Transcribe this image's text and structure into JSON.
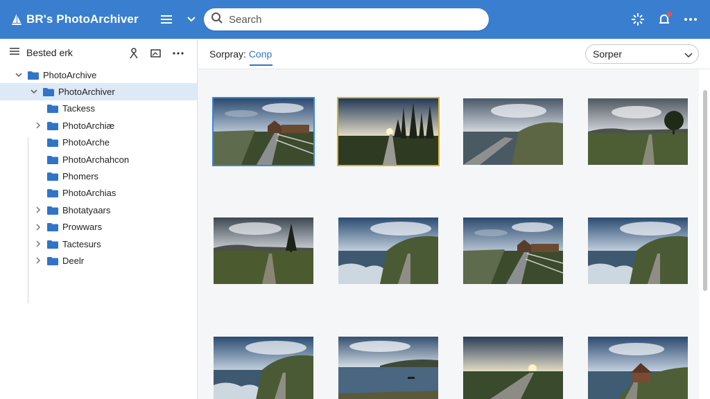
{
  "app": {
    "title": "BR's PhotoArchiver",
    "accent": "#3a7fcf"
  },
  "header": {
    "search_placeholder": "Search",
    "icons": [
      "menu-icon",
      "chevron-down-icon",
      "search-icon",
      "sparkle-icon",
      "bell-icon",
      "more-icon"
    ],
    "notification_badge_color": "#e8534a"
  },
  "sidebar": {
    "header_label": "Bested erk",
    "tree": [
      {
        "label": "PhotoArchive",
        "level": 0,
        "toggle": "expanded",
        "selected": false
      },
      {
        "label": "PhotoArchiver",
        "level": 1,
        "toggle": "expanded",
        "selected": true
      },
      {
        "label": "Tackess",
        "level": 2,
        "toggle": "none",
        "selected": false
      },
      {
        "label": "PhotoArchiæ",
        "level": 2,
        "toggle": "collapsed",
        "selected": false
      },
      {
        "label": "PhotoArche",
        "level": 2,
        "toggle": "none",
        "selected": false
      },
      {
        "label": "PhotoArchahcon",
        "level": 2,
        "toggle": "none",
        "selected": false
      },
      {
        "label": "Phomers",
        "level": 2,
        "toggle": "none",
        "selected": false
      },
      {
        "label": "PhotoArchias",
        "level": 2,
        "toggle": "none",
        "selected": false
      },
      {
        "label": "Bhotatyaars",
        "level": 2,
        "toggle": "collapsed",
        "selected": false
      },
      {
        "label": "Prowwars",
        "level": 2,
        "toggle": "collapsed",
        "selected": false
      },
      {
        "label": "Tactesurs",
        "level": 2,
        "toggle": "collapsed",
        "selected": false
      },
      {
        "label": "Deelr",
        "level": 2,
        "toggle": "collapsed",
        "selected": false
      }
    ]
  },
  "main": {
    "breadcrumb_key": "Sorpray:",
    "breadcrumb_value": "Conp",
    "sort_label": "Sorper",
    "photos": [
      {
        "scene": "boardwalk-hut",
        "selected": "blue"
      },
      {
        "scene": "sunset-path-trees",
        "selected": "gold"
      },
      {
        "scene": "coast-boardwalk",
        "selected": "none"
      },
      {
        "scene": "meadow-tree-path",
        "selected": "none"
      },
      {
        "scene": "tree-field-path",
        "selected": "none"
      },
      {
        "scene": "coast-waves-path",
        "selected": "none"
      },
      {
        "scene": "boardwalk-hut",
        "selected": "none"
      },
      {
        "scene": "coast-waves-path",
        "selected": "none"
      },
      {
        "scene": "coast-waves-path",
        "selected": "none"
      },
      {
        "scene": "lake-boat",
        "selected": "none"
      },
      {
        "scene": "sunset-road",
        "selected": "none"
      },
      {
        "scene": "cabin-hill",
        "selected": "none"
      }
    ]
  }
}
